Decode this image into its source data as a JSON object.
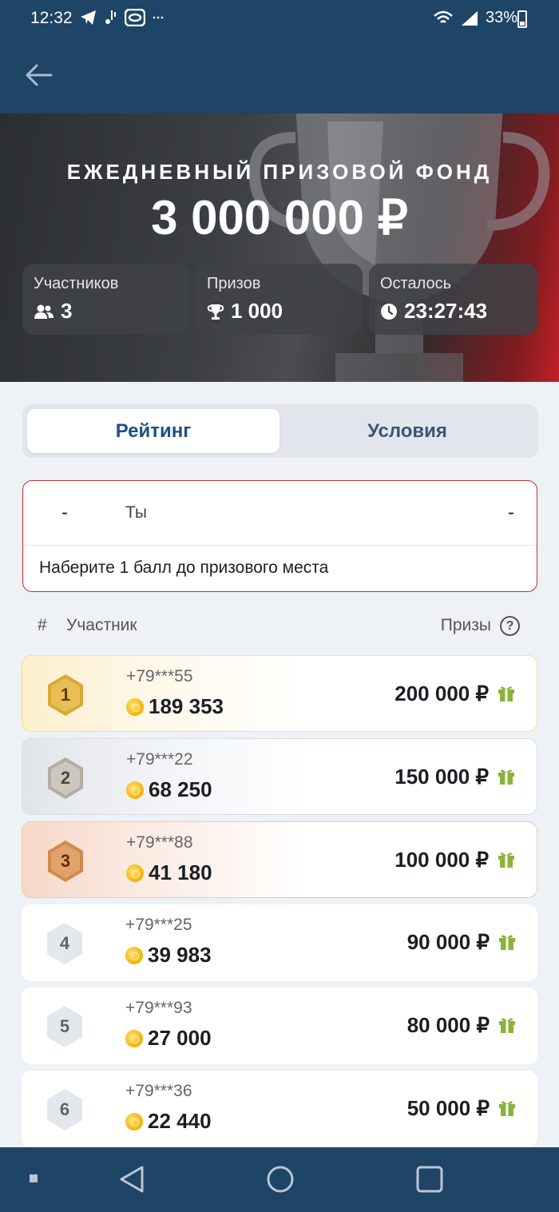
{
  "status_bar": {
    "time": "12:32",
    "battery": "33%",
    "icons": [
      "telegram-icon",
      "notification-icon",
      "app-icon",
      "more-icon",
      "wifi-icon",
      "signal-icon",
      "battery-icon"
    ]
  },
  "header": {
    "back_icon": "arrow-left-icon"
  },
  "hero": {
    "title": "ЕЖЕДНЕВНЫЙ ПРИЗОВОЙ ФОНД",
    "amount": "3 000 000 ₽",
    "stats": [
      {
        "label": "Участников",
        "value": "3",
        "icon": "users-icon"
      },
      {
        "label": "Призов",
        "value": "1 000",
        "icon": "trophy-icon"
      },
      {
        "label": "Осталось",
        "value": "23:27:43",
        "icon": "clock-icon"
      }
    ]
  },
  "tabs": [
    {
      "label": "Рейтинг",
      "active": true
    },
    {
      "label": "Условия",
      "active": false
    }
  ],
  "my_row": {
    "rank": "-",
    "name": "Ты",
    "prize": "-",
    "hint": "Наберите 1 балл до призового места"
  },
  "table_header": {
    "rank": "#",
    "participant": "Участник",
    "prizes": "Призы",
    "help": "?"
  },
  "leaderboard": [
    {
      "rank": "1",
      "phone": "+79***55",
      "score": "189 353",
      "prize": "200 000 ₽",
      "medal": "gold"
    },
    {
      "rank": "2",
      "phone": "+79***22",
      "score": "68 250",
      "prize": "150 000 ₽",
      "medal": "silver"
    },
    {
      "rank": "3",
      "phone": "+79***88",
      "score": "41 180",
      "prize": "100 000 ₽",
      "medal": "bronze"
    },
    {
      "rank": "4",
      "phone": "+79***25",
      "score": "39 983",
      "prize": "90 000 ₽",
      "medal": "none"
    },
    {
      "rank": "5",
      "phone": "+79***93",
      "score": "27 000",
      "prize": "80 000 ₽",
      "medal": "none"
    },
    {
      "rank": "6",
      "phone": "+79***36",
      "score": "22 440",
      "prize": "50 000 ₽",
      "medal": "none"
    }
  ],
  "colors": {
    "header": "#1e4466",
    "accent_red": "#c92b30",
    "tab_active_text": "#1e4f86",
    "gold": "#d9a93a",
    "silver": "#bdb7ad",
    "bronze": "#cf8a4f",
    "gift_green": "#8ab33a"
  },
  "nav_bar": {
    "icons": [
      "recent-apps-icon",
      "back-icon",
      "home-icon",
      "overview-icon"
    ]
  }
}
